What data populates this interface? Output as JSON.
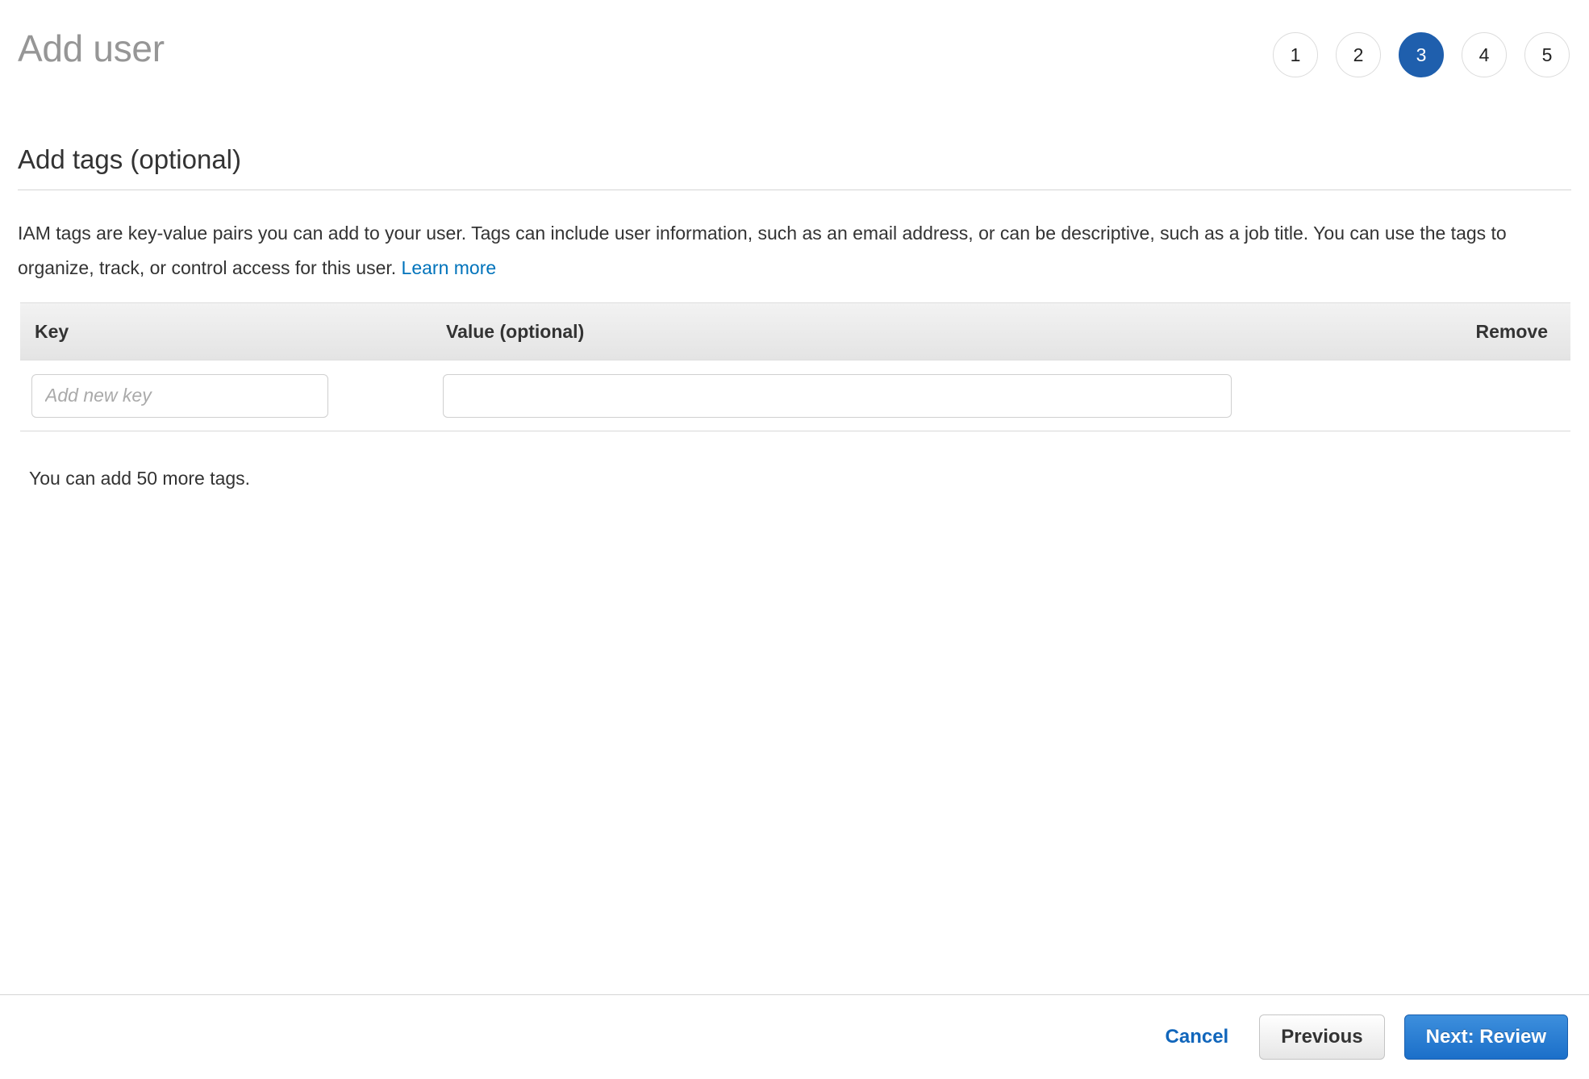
{
  "header": {
    "title": "Add user",
    "steps": [
      {
        "label": "1",
        "active": false
      },
      {
        "label": "2",
        "active": false
      },
      {
        "label": "3",
        "active": true
      },
      {
        "label": "4",
        "active": false
      },
      {
        "label": "5",
        "active": false
      }
    ]
  },
  "section": {
    "heading": "Add tags (optional)",
    "description_before_link": "IAM tags are key-value pairs you can add to your user. Tags can include user information, such as an email address, or can be descriptive, such as a job title. You can use the tags to organize, track, or control access for this user. ",
    "learn_more_label": "Learn more"
  },
  "tag_table": {
    "columns": {
      "key": "Key",
      "value": "Value (optional)",
      "remove": "Remove"
    },
    "rows": [
      {
        "key_value": "",
        "key_placeholder": "Add new key",
        "value_value": "",
        "value_placeholder": "",
        "remove_label": ""
      }
    ],
    "tags_remaining": "You can add 50 more tags."
  },
  "footer": {
    "cancel_label": "Cancel",
    "previous_label": "Previous",
    "next_label": "Next: Review"
  },
  "colors": {
    "accent_blue": "#1f5fad",
    "link_blue": "#0073bb",
    "cancel_blue": "#1166bb",
    "title_gray": "#969696",
    "text_dark": "#333333"
  }
}
